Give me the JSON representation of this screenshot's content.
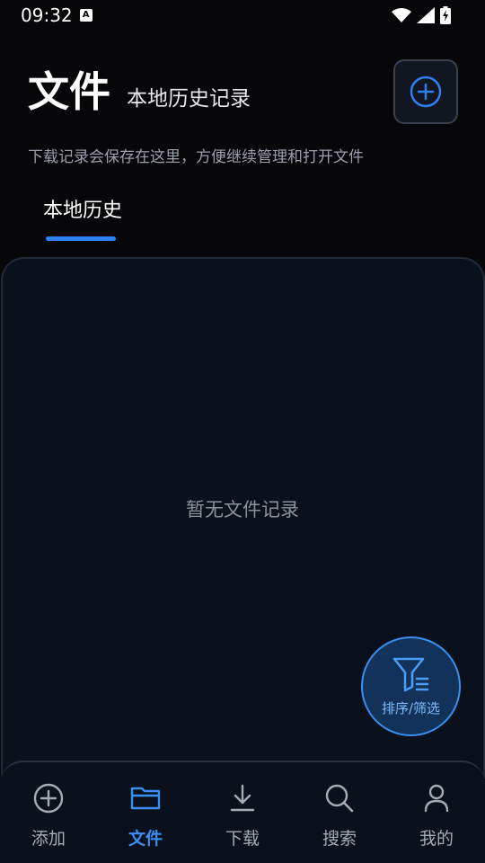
{
  "status_bar": {
    "time": "09:32",
    "notification_badge": "A"
  },
  "header": {
    "title": "文件",
    "subtitle": "本地历史记录",
    "description": "下载记录会保存在这里，方便继续管理和打开文件"
  },
  "tabs": [
    {
      "label": "本地历史",
      "active": true
    }
  ],
  "content": {
    "empty_text": "暂无文件记录"
  },
  "fab": {
    "label": "排序/筛选",
    "icon": "filter-icon"
  },
  "bottom_nav": [
    {
      "label": "添加",
      "icon": "add-circle-icon",
      "active": false
    },
    {
      "label": "文件",
      "icon": "folder-icon",
      "active": true
    },
    {
      "label": "下载",
      "icon": "download-icon",
      "active": false
    },
    {
      "label": "搜索",
      "icon": "search-icon",
      "active": false
    },
    {
      "label": "我的",
      "icon": "person-icon",
      "active": false
    }
  ],
  "colors": {
    "accent": "#3a8ff0",
    "background": "#070709",
    "panel": "#0b111c"
  }
}
